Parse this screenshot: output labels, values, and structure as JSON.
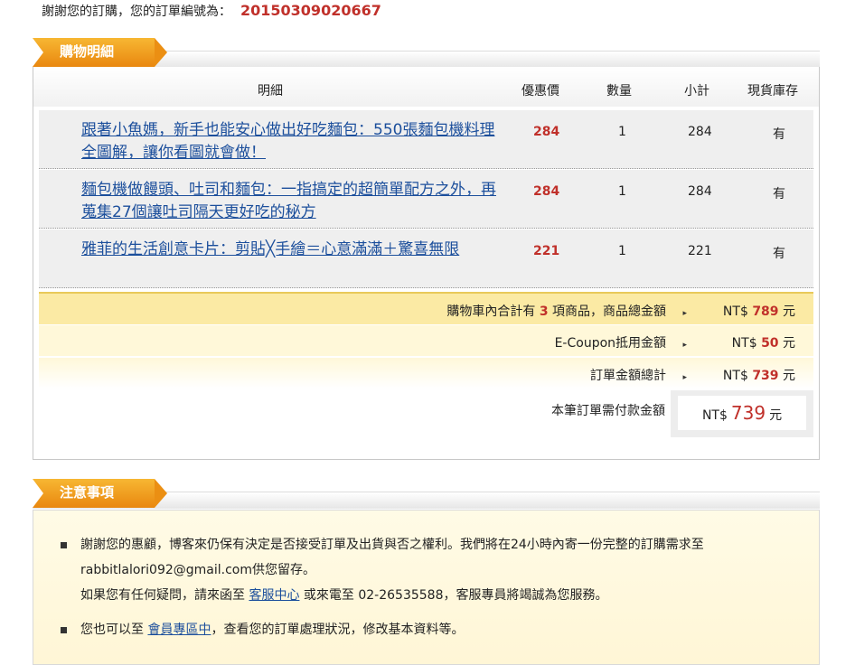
{
  "order": {
    "prefix": "謝謝您的訂購，您的訂單編號為：",
    "number": "20150309020667"
  },
  "cart_section": {
    "title": "購物明細"
  },
  "columns": {
    "detail": "明細",
    "price": "優惠價",
    "qty": "數量",
    "subtotal": "小計",
    "stock": "現貨庫存"
  },
  "items": [
    {
      "title": "跟著小魚媽，新手也能安心做出好吃麵包：550張麵包機料理全圖解，讓你看圖就會做！",
      "price": "284",
      "qty": "1",
      "subtotal": "284",
      "stock": "有"
    },
    {
      "title": "麵包機做饅頭、吐司和麵包：一指搞定的超簡單配方之外，再蒐集27個讓吐司隔天更好吃的秘方",
      "price": "284",
      "qty": "1",
      "subtotal": "284",
      "stock": "有"
    },
    {
      "title": "雅菲的生活創意卡片：剪貼╳手繪＝心意滿滿＋驚喜無限",
      "price": "221",
      "qty": "1",
      "subtotal": "221",
      "stock": "有"
    }
  ],
  "summary": {
    "cart_prefix": "購物車內合計有",
    "cart_count": "3",
    "cart_suffix": "項商品，商品總金額",
    "cart_total": "789",
    "coupon_label": "E-Coupon抵用金額",
    "coupon_value": "50",
    "order_total_label": "訂單金額總計",
    "order_total": "739",
    "currency": "NT$",
    "unit": "元",
    "pay_label": "本筆訂單需付款金額",
    "pay_amount": "739"
  },
  "notice_section": {
    "title": "注意事項",
    "line1": "謝謝您的惠顧，博客來仍保有決定是否接受訂單及出貨與否之權利。我們將在24小時內寄一份完整的訂購需求至rabbitlalori092@gmail.com供您留存。",
    "line2_pre": "如果您有任何疑問，請來函至",
    "line2_link": "客服中心",
    "line2_post": "或來電至 02-26535588，客服專員將竭誠為您服務。",
    "line3_pre": "您也可以至",
    "line3_link": "會員專區中",
    "line3_post": "，查看您的訂單處理狀況，修改基本資料等。"
  }
}
